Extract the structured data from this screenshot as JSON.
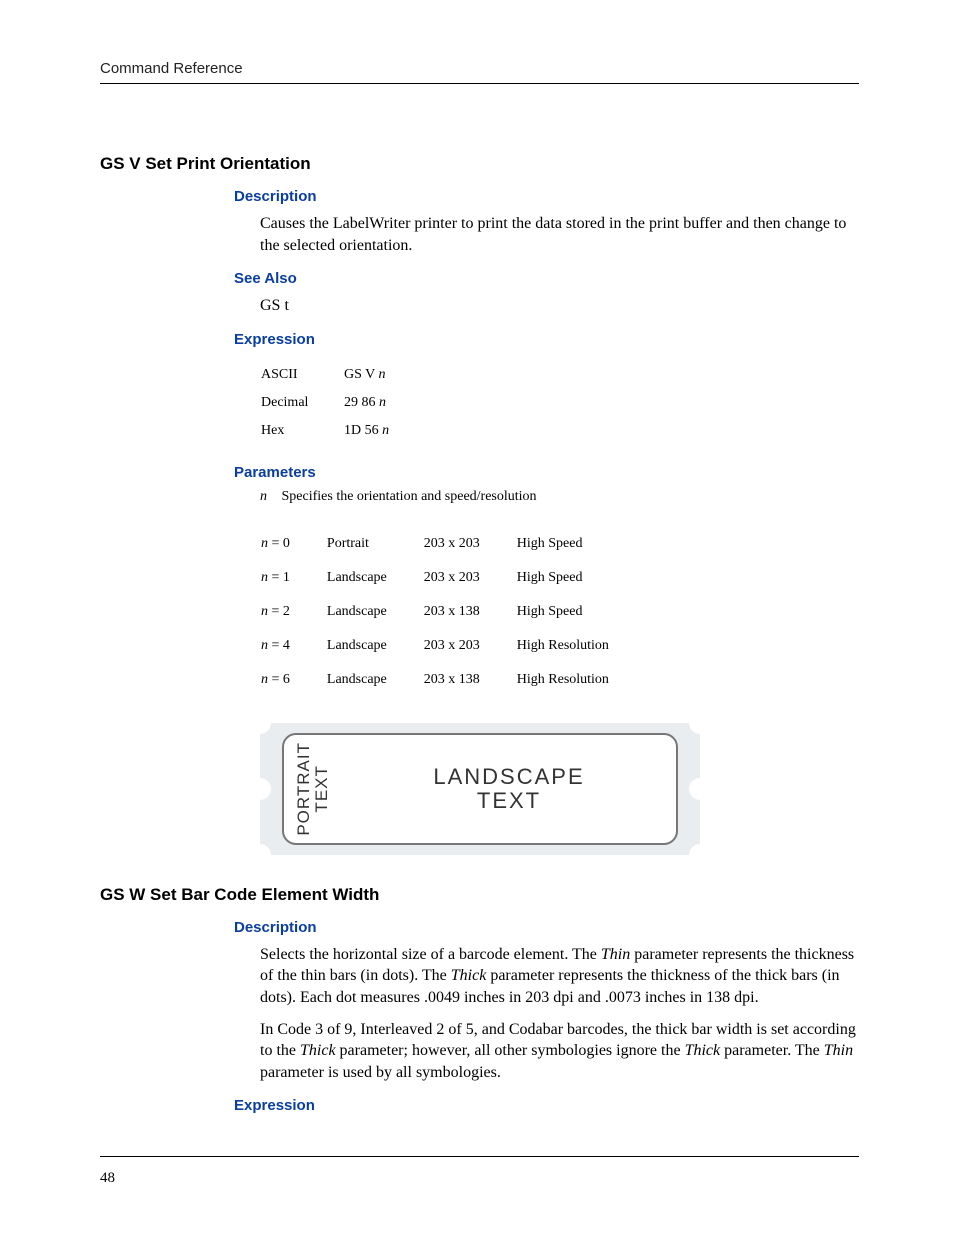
{
  "header": {
    "running": "Command Reference"
  },
  "page_number": "48",
  "sec1": {
    "title": "GS V Set Print Orientation",
    "description_h": "Description",
    "description_p": "Causes the LabelWriter printer to print the data stored in the print buffer and then change to the selected orientation.",
    "seealso_h": "See Also",
    "seealso_p": "GS t",
    "expression_h": "Expression",
    "expr": {
      "r0": {
        "a": "ASCII",
        "b": "GS V ",
        "n": "n"
      },
      "r1": {
        "a": "Decimal",
        "b": "29 86 ",
        "n": "n"
      },
      "r2": {
        "a": "Hex",
        "b": "1D 56 ",
        "n": "n"
      }
    },
    "parameters_h": "Parameters",
    "param_n": "n",
    "param_desc": "Specifies the orientation and speed/resolution",
    "orient": {
      "r0": {
        "n_lhs": "n",
        "eq": " = 0",
        "mode": "Portrait",
        "res": "203 x 203",
        "speed": "High Speed"
      },
      "r1": {
        "n_lhs": "n",
        "eq": " = 1",
        "mode": "Landscape",
        "res": "203 x 203",
        "speed": "High Speed"
      },
      "r2": {
        "n_lhs": "n",
        "eq": " = 2",
        "mode": "Landscape",
        "res": "203 x 138",
        "speed": "High Speed"
      },
      "r3": {
        "n_lhs": "n",
        "eq": " = 4",
        "mode": "Landscape",
        "res": "203 x 203",
        "speed": "High Resolution"
      },
      "r4": {
        "n_lhs": "n",
        "eq": " = 6",
        "mode": "Landscape",
        "res": "203 x 138",
        "speed": "High Resolution"
      }
    },
    "figure": {
      "portrait_l1": "PORTRAIT",
      "portrait_l2": "TEXT",
      "landscape_l1": "LANDSCAPE",
      "landscape_l2": "TEXT"
    }
  },
  "sec2": {
    "title": "GS W Set Bar Code Element Width",
    "description_h": "Description",
    "p1_a": "Selects the horizontal size of a barcode element. The ",
    "p1_thin": "Thin",
    "p1_b": " parameter represents the thickness of the thin bars (in dots). The ",
    "p1_thick": "Thick",
    "p1_c": " parameter represents the thickness of the thick bars (in dots). Each dot measures .0049 inches in 203 dpi and .0073 inches in 138 dpi.",
    "p2_a": "In Code 3 of 9, Interleaved 2 of 5, and Codabar barcodes, the thick bar width is set according to the ",
    "p2_thick": "Thick",
    "p2_b": " parameter; however, all other symbologies ignore the ",
    "p2_thick2": "Thick",
    "p2_c": " parameter. The ",
    "p2_thin": "Thin",
    "p2_d": " parameter is used by all symbologies.",
    "expression_h": "Expression"
  }
}
